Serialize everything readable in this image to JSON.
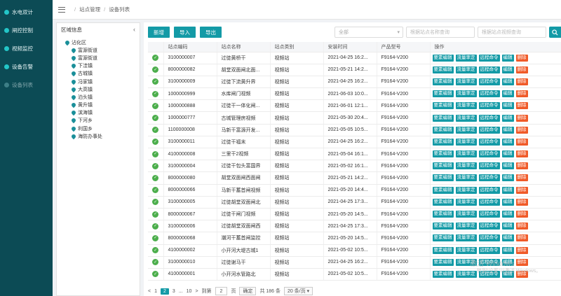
{
  "sidebar": {
    "items": [
      {
        "label": "水电双计",
        "disabled": false
      },
      {
        "label": "闸控控制",
        "disabled": false
      },
      {
        "label": "视频监控",
        "disabled": false
      },
      {
        "label": "设备告警",
        "disabled": false
      },
      {
        "label": "设备列表",
        "disabled": true
      }
    ]
  },
  "breadcrumb": {
    "items": [
      "站点管理",
      "设备列表"
    ]
  },
  "region": {
    "title": "区域信息",
    "root": "沾化区",
    "children": [
      "富源街道",
      "富源街道",
      "下洼镇",
      "古城镇",
      "冯家镇",
      "大高镇",
      "泊头镇",
      "黄升镇",
      "滨海镇",
      "下河乡",
      "利国乡",
      "海防办事处"
    ]
  },
  "toolbar": {
    "new_label": "新增",
    "import_label": "导入",
    "export_label": "导出",
    "select_value": "全部",
    "name_placeholder": "根据站点名称查询",
    "video_placeholder": "根据站点视频查询"
  },
  "table": {
    "headers": [
      "站点编码",
      "站点名称",
      "站点类别",
      "安装时间",
      "产品型号",
      "操作"
    ],
    "actions": [
      "要素编辑",
      "流量率定",
      "远程命令",
      "编辑",
      "删除"
    ],
    "rows": [
      [
        "3100000007",
        "过徒黄桥干",
        "视频站",
        "2021-04-25 16:2...",
        "F9164-V200"
      ],
      [
        "8000000082",
        "胡堂双面闸北面...",
        "视频站",
        "2021-05-21 14:2...",
        "F9164-V200"
      ],
      [
        "3100000009",
        "过徒下流黄升界",
        "视频站",
        "2021-04-25 16:2...",
        "F9164-V200"
      ],
      [
        "1000000999",
        "水库闸门视频",
        "视频站",
        "2021-06-03 10:0...",
        "F9164-V200"
      ],
      [
        "1000000888",
        "过徒干一体化闸...",
        "视频站",
        "2021-06-01 12:1...",
        "F9164-V200"
      ],
      [
        "1000000777",
        "古城管理房视频",
        "视频站",
        "2021-05-30 20:4...",
        "F9164-V200"
      ],
      [
        "1100000008",
        "马新干富源开发...",
        "视频站",
        "2021-05-05 10:5...",
        "F9164-V200"
      ],
      [
        "3100000011",
        "过徒干福末",
        "视频站",
        "2021-04-25 16:2...",
        "F9164-V200"
      ],
      [
        "4100000008",
        "三里干2视频",
        "视频站",
        "2021-05-04 16:1...",
        "F9164-V200"
      ],
      [
        "3100000004",
        "过徒干包头富国界",
        "视频站",
        "2021-05-02 16:1...",
        "F9164-V200"
      ],
      [
        "8000000080",
        "胡堂双面闸西面闸",
        "视频站",
        "2021-05-21 14:2...",
        "F9164-V200"
      ],
      [
        "8000000066",
        "马新干蓄首闸视频",
        "视频站",
        "2021-05-20 14:4...",
        "F9164-V200"
      ],
      [
        "3100000005",
        "过徒胡堂双面闸北",
        "视频站",
        "2021-04-25 17:3...",
        "F9164-V200"
      ],
      [
        "8000000067",
        "过徒干闸门视频",
        "视频站",
        "2021-05-20 14:5...",
        "F9164-V200"
      ],
      [
        "3100000006",
        "过徒胡堂双面闸西",
        "视频站",
        "2021-04-25 17:3...",
        "F9164-V200"
      ],
      [
        "8000000068",
        "潮河干蓄首闸监控",
        "视频站",
        "2021-05-20 14:5...",
        "F9164-V200"
      ],
      [
        "4100000002",
        "小开河大堤古城1",
        "视频站",
        "2021-05-02 10:5...",
        "F9164-V200"
      ],
      [
        "3100000010",
        "过徒谢马干",
        "视频站",
        "2021-04-25 16:2...",
        "F9164-V200"
      ],
      [
        "4100000001",
        "小开河水管路北",
        "视频站",
        "2021-05-02 10:5...",
        "F9164-V200"
      ]
    ]
  },
  "pagination": {
    "prev": "<",
    "pages": [
      "1",
      "2",
      "3"
    ],
    "ellipsis": "...",
    "last": "10",
    "next": ">",
    "goto_label": "到第",
    "goto_value": "2",
    "page_unit": "页",
    "confirm": "确定",
    "total": "共 186 条",
    "page_size": "20 条/页"
  },
  "watermark": {
    "line1": "激活 Windows",
    "line2": "转到\"设置\"以激活 Windows。"
  }
}
